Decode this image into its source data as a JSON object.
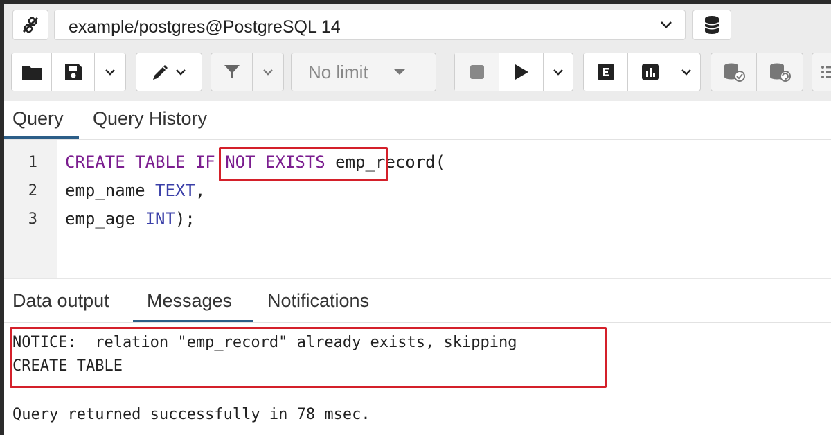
{
  "connection": {
    "label": "example/postgres@PostgreSQL 14",
    "icon": "plug-disconnect-icon",
    "db_icon": "database-icon"
  },
  "toolbar": {
    "limit_value": "No limit",
    "icons": [
      "folder-icon",
      "save-icon",
      "edit-icon",
      "filter-icon",
      "stop-icon",
      "execute-icon",
      "explain-icon",
      "explain-analyze-icon",
      "commit-icon",
      "rollback-icon",
      "macros-icon"
    ]
  },
  "editor_tabs": [
    "Query",
    "Query History"
  ],
  "active_editor_tab": "Query",
  "editor": {
    "line_numbers": [
      "1",
      "2",
      "3"
    ],
    "line1": {
      "kw1": "CREATE TABLE ",
      "kw2": "IF NOT EXISTS",
      "rest": " emp_record("
    },
    "line2": {
      "name": "emp_name ",
      "type": "TEXT",
      "rest": ","
    },
    "line3": {
      "name": "emp_age ",
      "type": "INT",
      "rest": ");"
    }
  },
  "output_tabs": [
    "Data output",
    "Messages",
    "Notifications"
  ],
  "active_output_tab": "Messages",
  "messages": {
    "notice": "NOTICE:  relation \"emp_record\" already exists, skipping",
    "command": "CREATE TABLE",
    "status": "Query returned successfully in 78 msec."
  },
  "colors": {
    "highlight_red": "#d4202a",
    "keyword": "#7b1d8f",
    "type": "#3a3fa8",
    "active_tab": "#2c5e88"
  }
}
